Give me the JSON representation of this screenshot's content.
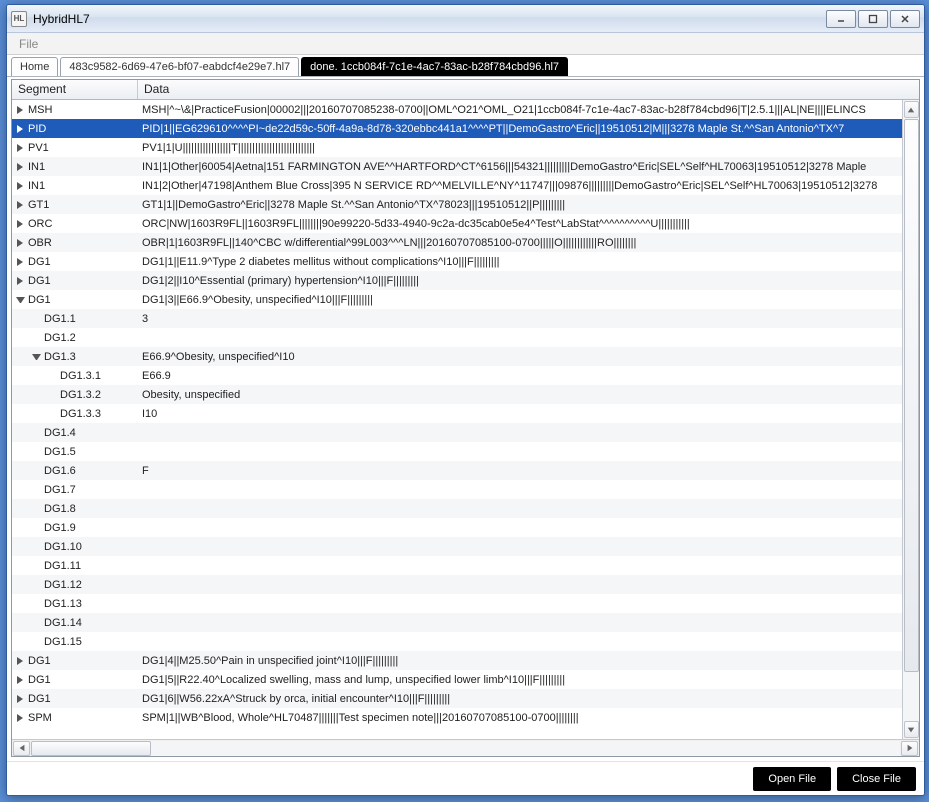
{
  "window": {
    "title": "HybridHL7"
  },
  "menubar": {
    "file": "File"
  },
  "tabs": {
    "home": "Home",
    "filename1": "483c9582-6d69-47e6-bf07-eabdcf4e29e7.hl7",
    "filename2": "done. 1ccb084f-7c1e-4ac7-83ac-b28f784cbd96.hl7"
  },
  "grid": {
    "headers": {
      "segment": "Segment",
      "data": "Data"
    },
    "rows": [
      {
        "seg": "MSH",
        "depth": 0,
        "arrow": "right",
        "selected": false,
        "data": "MSH|^~\\&|PracticeFusion|00002|||20160707085238-0700||OML^O21^OML_O21|1ccb084f-7c1e-4ac7-83ac-b28f784cbd96|T|2.5.1|||AL|NE||||ELINCS"
      },
      {
        "seg": "PID",
        "depth": 0,
        "arrow": "right",
        "selected": true,
        "data": "PID|1||EG629610^^^^PI~de22d59c-50ff-4a9a-8d78-320ebbc441a1^^^^PT||DemoGastro^Eric||19510512|M|||3278 Maple St.^^San Antonio^TX^7"
      },
      {
        "seg": "PV1",
        "depth": 0,
        "arrow": "right",
        "selected": false,
        "data": "PV1|1|U|||||||||||||||||T|||||||||||||||||||||||||||"
      },
      {
        "seg": "IN1",
        "depth": 0,
        "arrow": "right",
        "selected": false,
        "data": "IN1|1|Other|60054|Aetna|151 FARMINGTON AVE^^HARTFORD^CT^6156|||54321|||||||||DemoGastro^Eric|SEL^Self^HL70063|19510512|3278 Maple"
      },
      {
        "seg": "IN1",
        "depth": 0,
        "arrow": "right",
        "selected": false,
        "data": "IN1|2|Other|47198|Anthem Blue Cross|395 N SERVICE RD^^MELVILLE^NY^11747|||09876|||||||||DemoGastro^Eric|SEL^Self^HL70063|19510512|3278"
      },
      {
        "seg": "GT1",
        "depth": 0,
        "arrow": "right",
        "selected": false,
        "data": "GT1|1||DemoGastro^Eric||3278 Maple St.^^San Antonio^TX^78023|||19510512||P|||||||||"
      },
      {
        "seg": "ORC",
        "depth": 0,
        "arrow": "right",
        "selected": false,
        "data": "ORC|NW|1603R9FL||1603R9FL||||||||90e99220-5d33-4940-9c2a-dc35cab0e5e4^Test^LabStat^^^^^^^^^^U|||||||||||"
      },
      {
        "seg": "OBR",
        "depth": 0,
        "arrow": "right",
        "selected": false,
        "data": "OBR|1|1603R9FL||140^CBC w/differential^99L003^^^LN|||20160707085100-0700|||||O||||||||||||RO||||||||"
      },
      {
        "seg": "DG1",
        "depth": 0,
        "arrow": "right",
        "selected": false,
        "data": "DG1|1||E11.9^Type 2 diabetes mellitus without complications^I10|||F|||||||||"
      },
      {
        "seg": "DG1",
        "depth": 0,
        "arrow": "right",
        "selected": false,
        "data": "DG1|2||I10^Essential (primary) hypertension^I10|||F|||||||||"
      },
      {
        "seg": "DG1",
        "depth": 0,
        "arrow": "down",
        "selected": false,
        "data": "DG1|3||E66.9^Obesity, unspecified^I10|||F|||||||||"
      },
      {
        "seg": "DG1.1",
        "depth": 1,
        "arrow": "",
        "selected": false,
        "data": "3"
      },
      {
        "seg": "DG1.2",
        "depth": 1,
        "arrow": "",
        "selected": false,
        "data": ""
      },
      {
        "seg": "DG1.3",
        "depth": 1,
        "arrow": "down",
        "selected": false,
        "data": "E66.9^Obesity, unspecified^I10"
      },
      {
        "seg": "DG1.3.1",
        "depth": 2,
        "arrow": "",
        "selected": false,
        "data": "E66.9"
      },
      {
        "seg": "DG1.3.2",
        "depth": 2,
        "arrow": "",
        "selected": false,
        "data": "Obesity, unspecified"
      },
      {
        "seg": "DG1.3.3",
        "depth": 2,
        "arrow": "",
        "selected": false,
        "data": "I10"
      },
      {
        "seg": "DG1.4",
        "depth": 1,
        "arrow": "",
        "selected": false,
        "data": ""
      },
      {
        "seg": "DG1.5",
        "depth": 1,
        "arrow": "",
        "selected": false,
        "data": ""
      },
      {
        "seg": "DG1.6",
        "depth": 1,
        "arrow": "",
        "selected": false,
        "data": "F"
      },
      {
        "seg": "DG1.7",
        "depth": 1,
        "arrow": "",
        "selected": false,
        "data": ""
      },
      {
        "seg": "DG1.8",
        "depth": 1,
        "arrow": "",
        "selected": false,
        "data": ""
      },
      {
        "seg": "DG1.9",
        "depth": 1,
        "arrow": "",
        "selected": false,
        "data": ""
      },
      {
        "seg": "DG1.10",
        "depth": 1,
        "arrow": "",
        "selected": false,
        "data": ""
      },
      {
        "seg": "DG1.11",
        "depth": 1,
        "arrow": "",
        "selected": false,
        "data": ""
      },
      {
        "seg": "DG1.12",
        "depth": 1,
        "arrow": "",
        "selected": false,
        "data": ""
      },
      {
        "seg": "DG1.13",
        "depth": 1,
        "arrow": "",
        "selected": false,
        "data": ""
      },
      {
        "seg": "DG1.14",
        "depth": 1,
        "arrow": "",
        "selected": false,
        "data": ""
      },
      {
        "seg": "DG1.15",
        "depth": 1,
        "arrow": "",
        "selected": false,
        "data": ""
      },
      {
        "seg": "DG1",
        "depth": 0,
        "arrow": "right",
        "selected": false,
        "data": "DG1|4||M25.50^Pain in unspecified joint^I10|||F|||||||||"
      },
      {
        "seg": "DG1",
        "depth": 0,
        "arrow": "right",
        "selected": false,
        "data": "DG1|5||R22.40^Localized swelling, mass and lump, unspecified lower limb^I10|||F|||||||||"
      },
      {
        "seg": "DG1",
        "depth": 0,
        "arrow": "right",
        "selected": false,
        "data": "DG1|6||W56.22xA^Struck by orca, initial encounter^I10|||F|||||||||"
      },
      {
        "seg": "SPM",
        "depth": 0,
        "arrow": "right",
        "selected": false,
        "data": "SPM|1||WB^Blood, Whole^HL70487|||||||Test specimen note|||20160707085100-0700||||||||"
      }
    ]
  },
  "footer": {
    "open": "Open File",
    "close": "Close File"
  }
}
